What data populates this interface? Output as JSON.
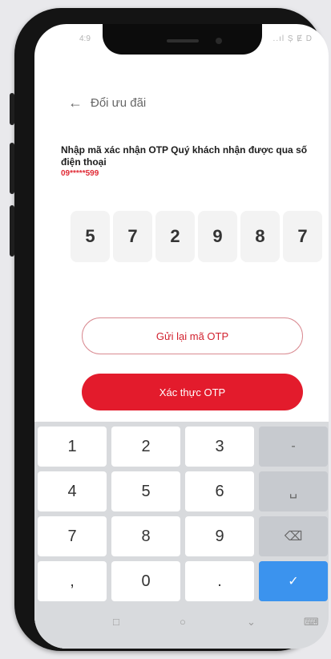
{
  "status_bar": {
    "time": "4:9",
    "indicators": "..ıl Ș Ɇ D"
  },
  "header": {
    "back_icon": "←",
    "title": "Đổi ưu đãi"
  },
  "otp": {
    "prompt": "Nhập mã xác nhận OTP Quý khách nhận được qua số điện thoại",
    "phone_number": "09*****599",
    "digits": [
      "5",
      "7",
      "2",
      "9",
      "8",
      "7"
    ]
  },
  "buttons": {
    "resend": "Gửi lại mã OTP",
    "verify": "Xác thực OTP"
  },
  "keyboard": {
    "keys": [
      "1",
      "2",
      "3",
      "-",
      "4",
      "5",
      "6",
      "␣",
      "7",
      "8",
      "9",
      "⌫",
      ",",
      "0",
      ".",
      "✓"
    ]
  },
  "navbar": {
    "items": [
      "□",
      "○",
      "⌄",
      "⌨"
    ]
  },
  "colors": {
    "accent": "#e31b2c",
    "phone_number": "#e02a35",
    "done_key": "#3b93ee"
  }
}
